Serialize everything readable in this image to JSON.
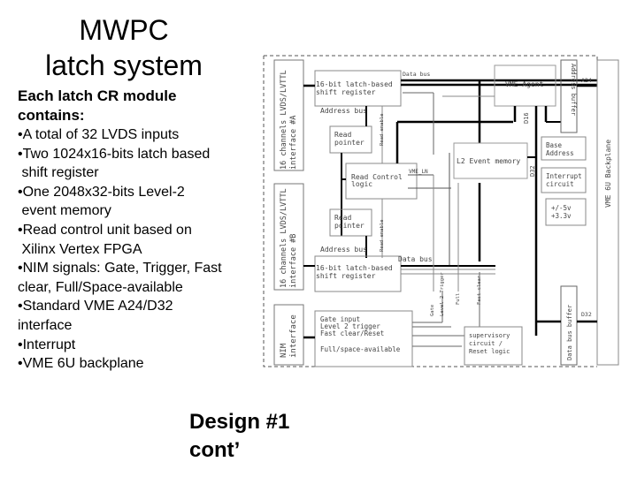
{
  "slide": {
    "title_line1": "MWPC",
    "title_line2": "latch system",
    "intro_line1": "Each latch CR module",
    "intro_line2": "contains:",
    "bullets": [
      "•A total of 32 LVDS inputs",
      "•Two 1024x16-bits latch based",
      " shift register",
      "•One 2048x32-bits Level-2",
      " event memory",
      "•Read control unit based on",
      " Xilinx Vertex FPGA",
      "•NIM signals: Gate, Trigger, Fast",
      "clear, Full/Space-available",
      "•Standard VME A24/D32",
      "interface",
      "•Interrupt",
      "•VME 6U backplane"
    ],
    "footer_line1": "Design #1",
    "footer_line2": "cont’"
  },
  "diagram": {
    "interface_a": "16 channels LVDS/LVTTL interface #A",
    "interface_a_l1": "16 channels LVDS/LVTTL",
    "interface_a_l2": "interface #A",
    "interface_b_l1": "16 channels LVDS/LVTTL",
    "interface_b_l2": "interface #B",
    "nim_l1": "NIM",
    "nim_l2": "interface",
    "shift_reg_top_l1": "16-bit latch-based",
    "shift_reg_top_l2": "shift register",
    "shift_reg_bot_l1": "16-bit latch-based",
    "shift_reg_bot_l2": "shift register",
    "address_bus_top": "Address bus",
    "address_bus_bot": "Address bus",
    "data_bus_top": "Data bus",
    "data_bus_bot": "Data bus",
    "read_pointer_top_l1": "Read",
    "read_pointer_top_l2": "pointer",
    "read_pointer_bot_l1": "Read",
    "read_pointer_bot_l2": "pointer",
    "read_enable_top": "Read enable",
    "read_enable_bot": "Read enable",
    "read_control_l1": "Read Control",
    "read_control_l2": "logic",
    "vme_ln": "VME_LN",
    "event_memory": "L2 Event memory",
    "vme_agent": "VME Agent",
    "address_buffer": "Address buffer",
    "a24": "A24",
    "d16": "D16",
    "d32_mem": "D32",
    "d32_bus": "D32",
    "base_address_l1": "Base",
    "base_address_l2": "Address",
    "interrupt_l1": "Interrupt",
    "interrupt_l2": "circuit",
    "power_l1": "+/-5v",
    "power_l2": "+3.3v",
    "vme_backplane": "VME 6U Backplane",
    "nim_box_l1": "Gate input",
    "nim_box_l2": "Level 2 trigger",
    "nim_box_l3": "Fast clear/Reset",
    "nim_box_l4": "Full/space-available",
    "gate": "Gate",
    "level2_trigger": "Level 2 Trigger",
    "full": "Full",
    "fast_clear": "Fast clear",
    "supervisory_l1": "supervisory",
    "supervisory_l2": "circuit /",
    "supervisory_l3": "Reset logic",
    "data_bus_buffer": "Data bus buffer"
  }
}
